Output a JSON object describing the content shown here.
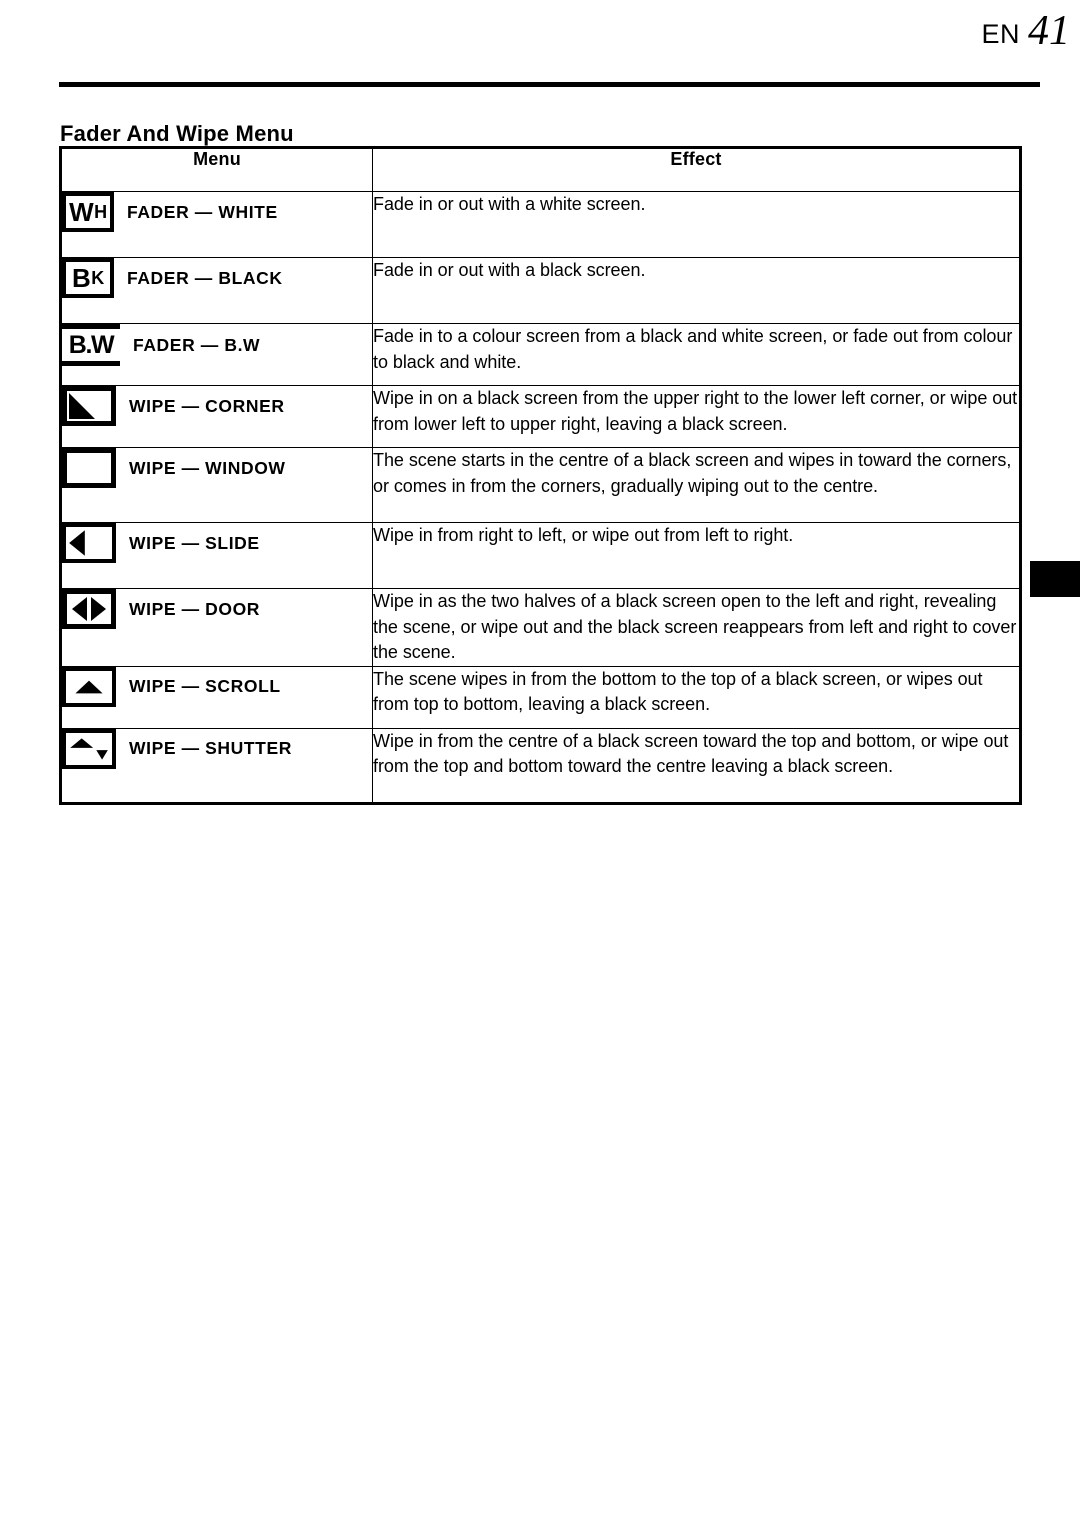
{
  "header": {
    "label": "EN",
    "page_number": "41"
  },
  "section": {
    "title": "Fader And Wipe Menu"
  },
  "table": {
    "columns": [
      "Menu",
      "Effect"
    ],
    "rows": [
      {
        "icon": "fader-white-icon",
        "icon_text": {
          "big": "W",
          "small": "H"
        },
        "menu": "FADER — WHITE",
        "effect": "Fade in or out with a white screen."
      },
      {
        "icon": "fader-black-icon",
        "icon_text": {
          "big": "B",
          "small": "K"
        },
        "menu": "FADER — BLACK",
        "effect": "Fade in or out with a black screen."
      },
      {
        "icon": "fader-bw-icon",
        "icon_text": {
          "big": "B.W",
          "small": ""
        },
        "menu": "FADER — B.W",
        "effect": "Fade in to a colour screen from a black and white screen, or fade out from colour to black and white."
      },
      {
        "icon": "wipe-corner-icon",
        "menu": "WIPE — CORNER",
        "effect": "Wipe in on a black screen from the upper right to the lower left corner, or wipe out from lower left to upper right, leaving a black screen."
      },
      {
        "icon": "wipe-window-icon",
        "menu": "WIPE — WINDOW",
        "effect": "The scene starts in the centre of a black screen and wipes in toward the corners, or comes in from the corners, gradually wiping out to the centre."
      },
      {
        "icon": "wipe-slide-icon",
        "menu": "WIPE — SLIDE",
        "effect": "Wipe in from right to left, or wipe out from left to right."
      },
      {
        "icon": "wipe-door-icon",
        "menu": "WIPE — DOOR",
        "effect": "Wipe in as the two halves of a black screen open to the left and right, revealing the scene, or wipe out and the black screen reappears from left and right to cover the scene."
      },
      {
        "icon": "wipe-scroll-icon",
        "menu": "WIPE — SCROLL",
        "effect": "The scene wipes in from the bottom to the top of a black screen, or wipes out from top to bottom, leaving a black screen."
      },
      {
        "icon": "wipe-shutter-icon",
        "menu": "WIPE — SHUTTER",
        "effect": "Wipe in from the centre of a black screen toward the top and bottom, or wipe out from the top and bottom toward the centre leaving a black screen."
      }
    ]
  },
  "thumb_tab": {
    "color": "#000000"
  }
}
